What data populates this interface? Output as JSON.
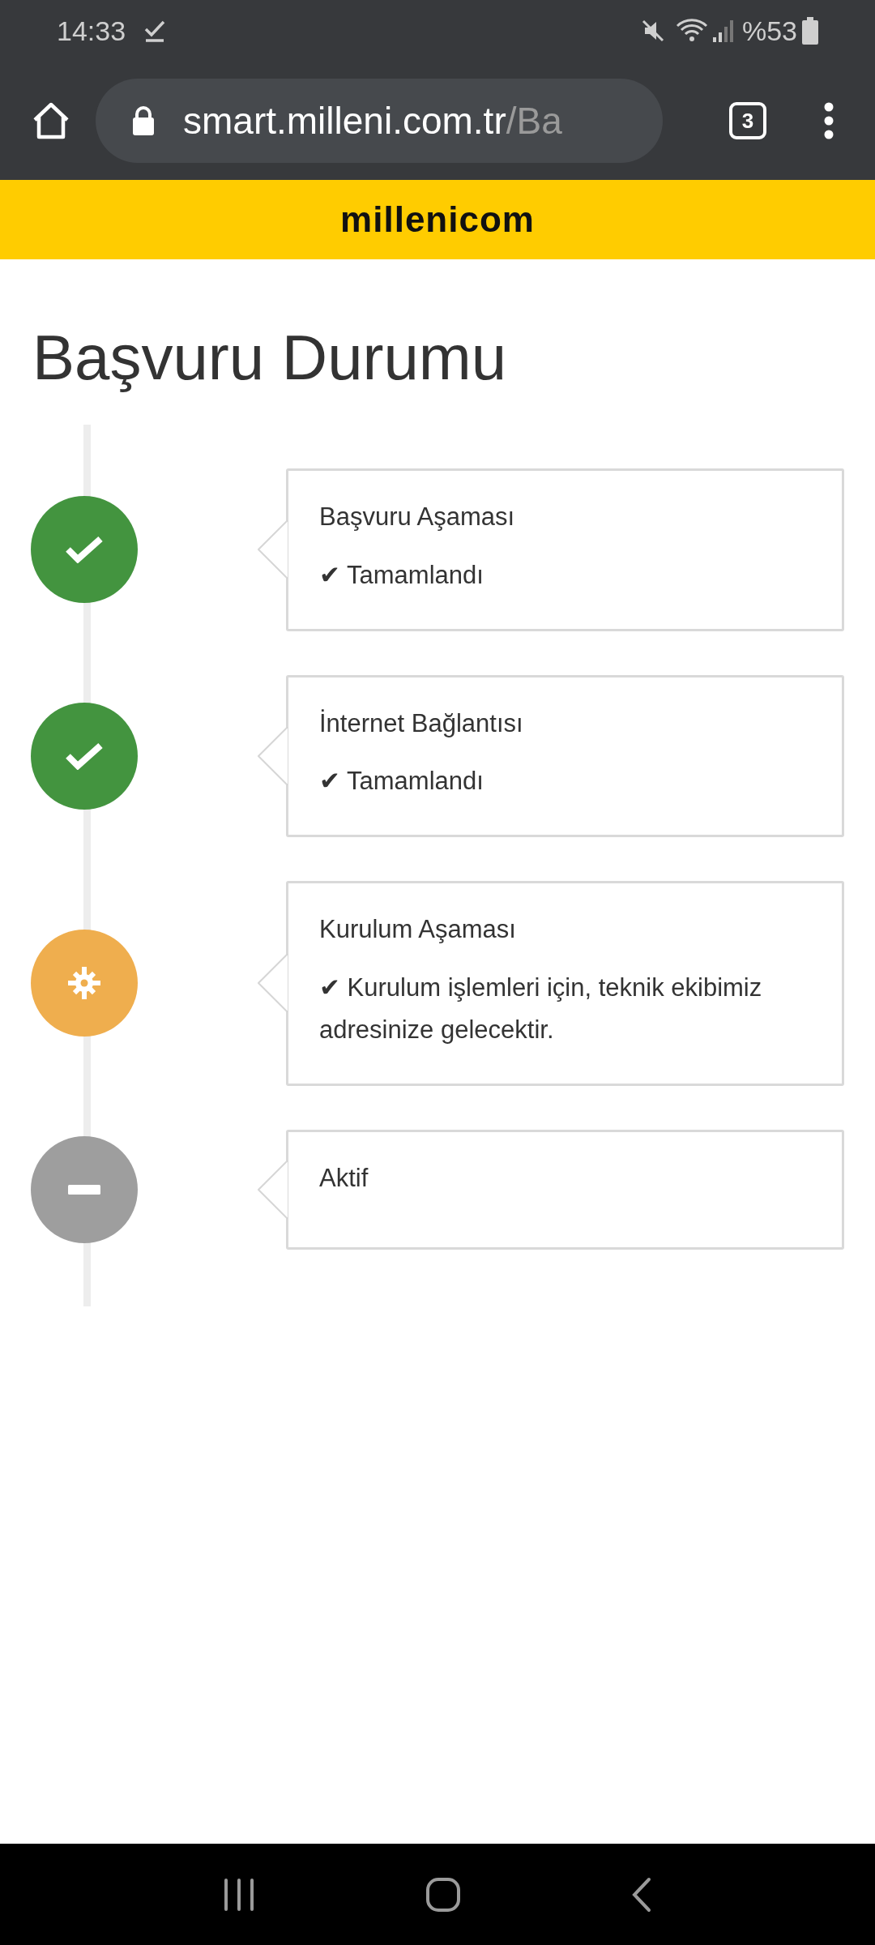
{
  "status_bar": {
    "time": "14:33",
    "battery": "%53"
  },
  "browser": {
    "url_host": "smart.milleni.com.tr",
    "url_path": "/Ba",
    "tab_count": "3"
  },
  "header": {
    "logo": "millenicom"
  },
  "page": {
    "title": "Başvuru Durumu"
  },
  "steps": [
    {
      "kind": "done",
      "title": "Başvuru Aşaması",
      "detail": "✔ Tamamlandı"
    },
    {
      "kind": "done",
      "title": "İnternet Bağlantısı",
      "detail": "✔ Tamamlandı"
    },
    {
      "kind": "in_progress",
      "title": "Kurulum Aşaması",
      "detail": "✔ Kurulum işlemleri için, teknik ekibimiz adresinize gelecektir."
    },
    {
      "kind": "pending",
      "title": "Aktif"
    }
  ]
}
